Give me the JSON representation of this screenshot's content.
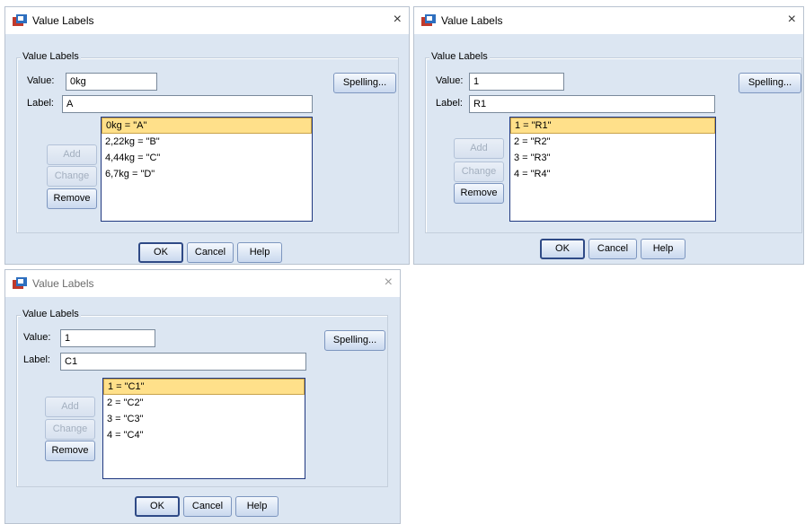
{
  "dialogs": [
    {
      "title": "Value Labels",
      "group_label": "Value Labels",
      "value_label": "Value:",
      "value": "0kg",
      "label_label": "Label:",
      "label": "A",
      "spelling_label": "Spelling...",
      "list": [
        "0kg = \"A\"",
        "2,22kg = \"B\"",
        "4,44kg = \"C\"",
        "6,7kg = \"D\""
      ],
      "selected_index": 0,
      "add_label": "Add",
      "change_label": "Change",
      "remove_label": "Remove",
      "ok_label": "OK",
      "cancel_label": "Cancel",
      "help_label": "Help"
    },
    {
      "title": "Value Labels",
      "group_label": "Value Labels",
      "value_label": "Value:",
      "value": "1",
      "label_label": "Label:",
      "label": "R1",
      "spelling_label": "Spelling...",
      "list": [
        "1 = \"R1\"",
        "2 = \"R2\"",
        "3 = \"R3\"",
        "4 = \"R4\""
      ],
      "selected_index": 0,
      "add_label": "Add",
      "change_label": "Change",
      "remove_label": "Remove",
      "ok_label": "OK",
      "cancel_label": "Cancel",
      "help_label": "Help"
    },
    {
      "title": "Value Labels",
      "group_label": "Value Labels",
      "value_label": "Value:",
      "value": "1",
      "label_label": "Label:",
      "label": "C1",
      "spelling_label": "Spelling...",
      "list": [
        "1 = \"C1\"",
        "2 = \"C2\"",
        "3 = \"C3\"",
        "4 = \"C4\""
      ],
      "selected_index": 0,
      "add_label": "Add",
      "change_label": "Change",
      "remove_label": "Remove",
      "ok_label": "OK",
      "cancel_label": "Cancel",
      "help_label": "Help"
    }
  ],
  "close_glyph": "×",
  "colors": {
    "client_bg": "#dce6f2",
    "selection": "#ffe08a",
    "list_border": "#203880"
  }
}
